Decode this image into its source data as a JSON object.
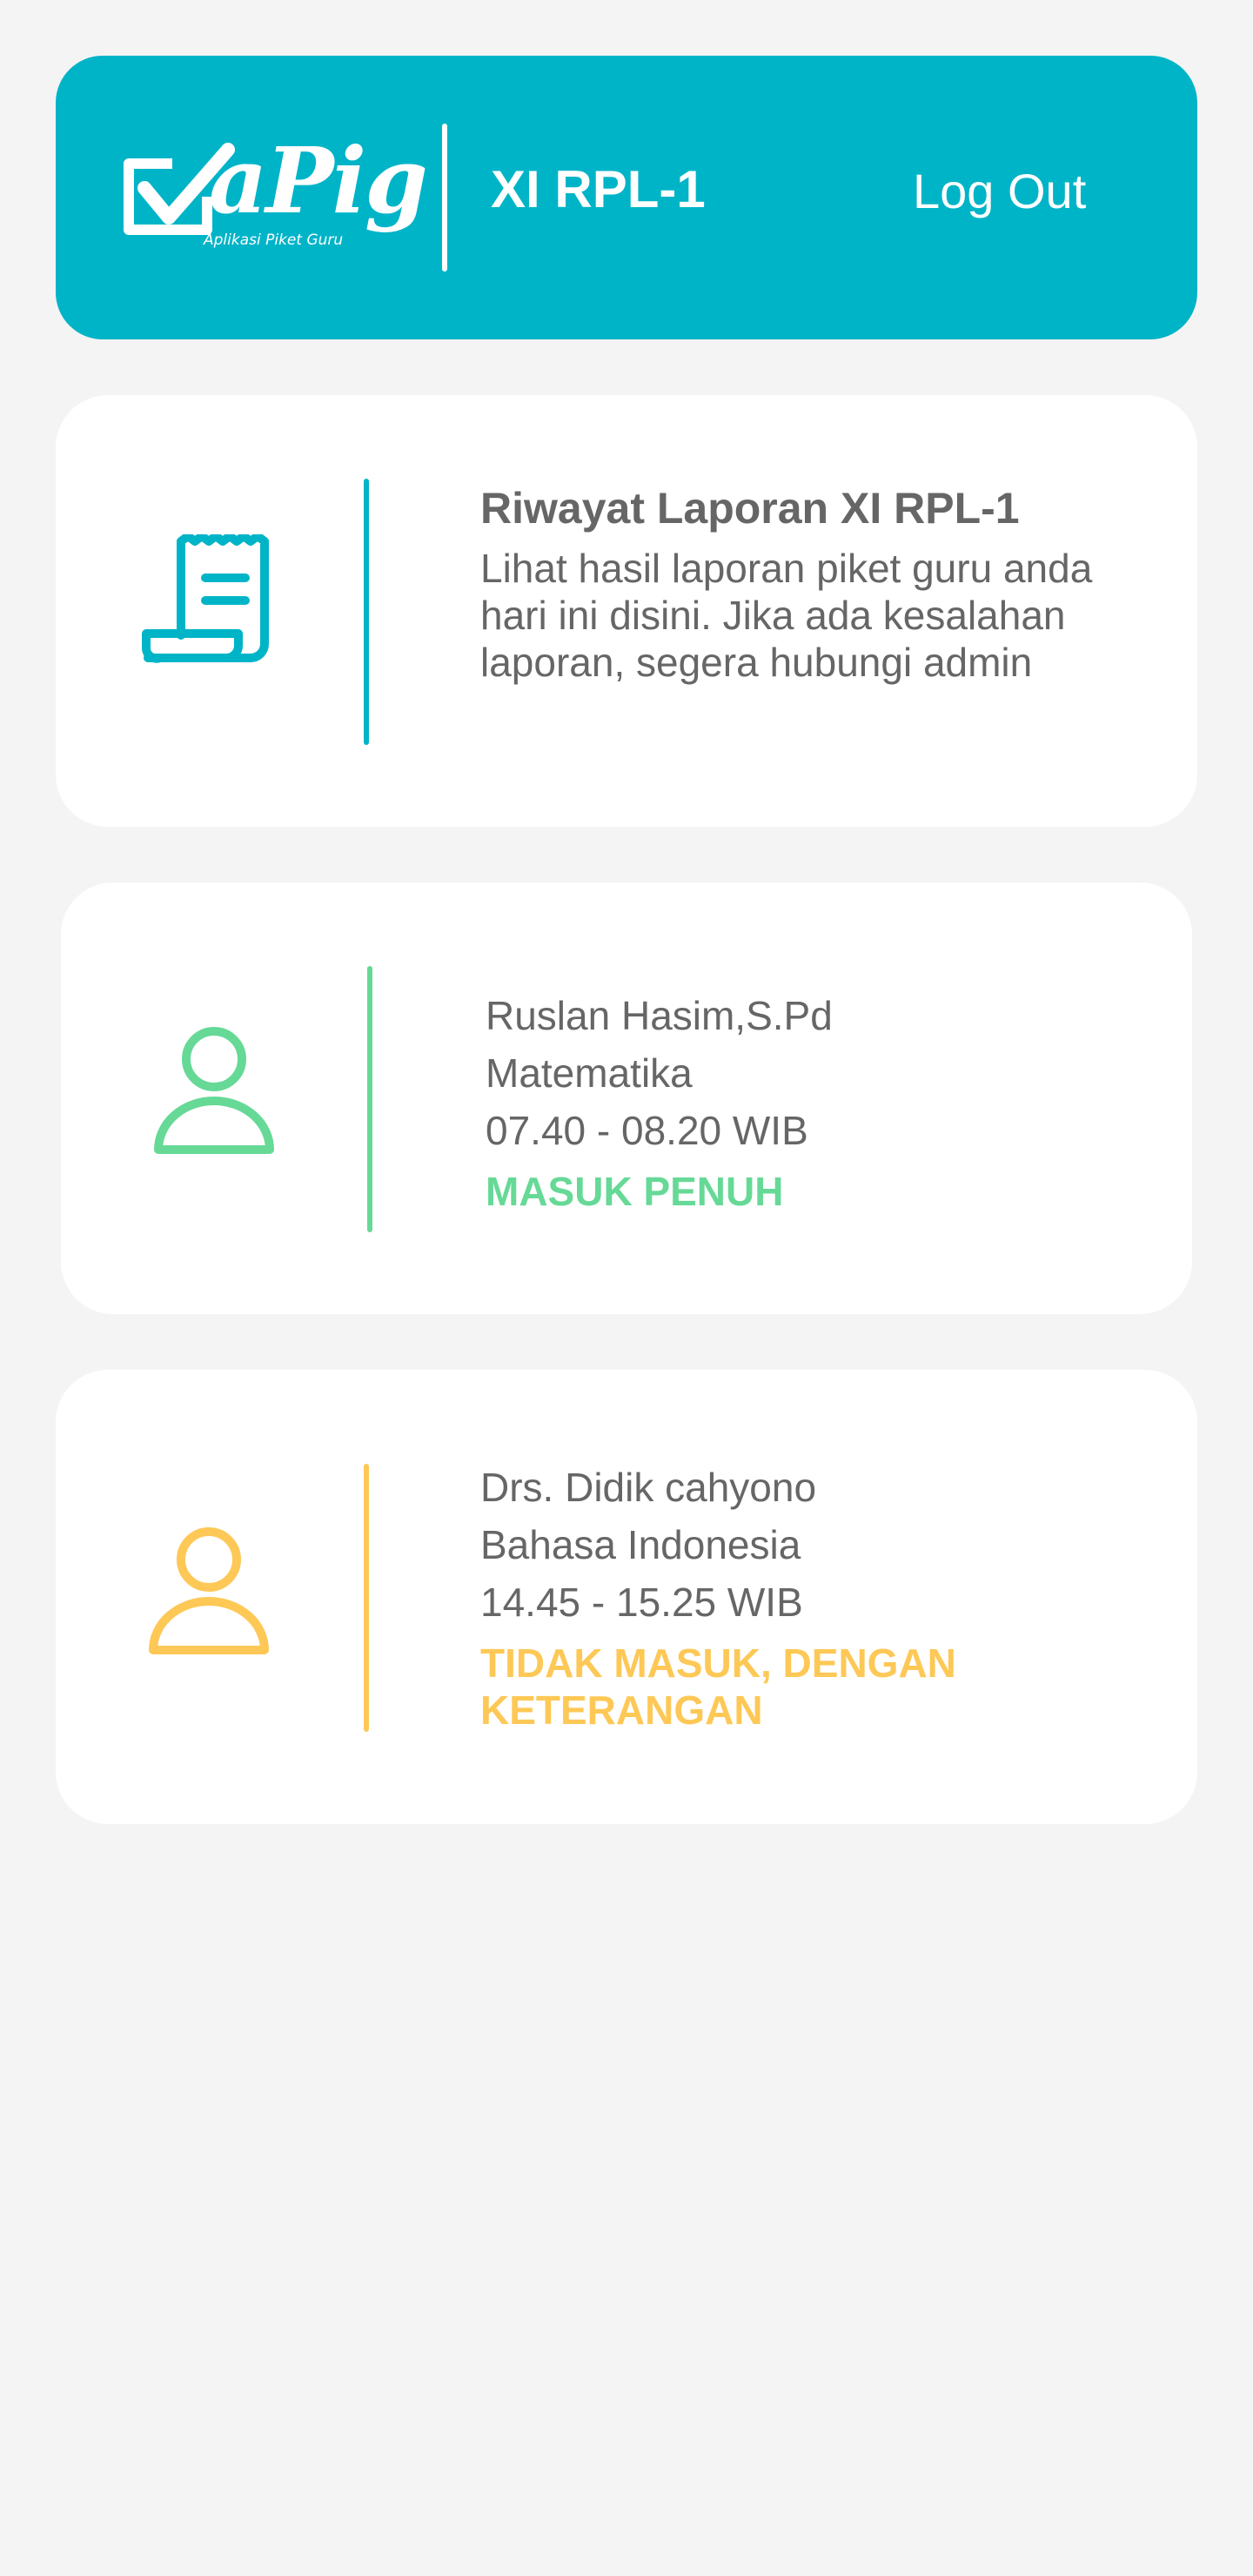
{
  "app": {
    "logo_text": "aPig",
    "logo_subtitle": "Aplikasi Piket Guru",
    "class_name": "XI RPL-1",
    "logout_label": "Log Out"
  },
  "colors": {
    "primary": "#00b4c8",
    "present": "#66d996",
    "absent": "#fdc856",
    "text": "#666666"
  },
  "report_card": {
    "icon": "receipt-scroll-icon",
    "title": "Riwayat Laporan XI RPL-1",
    "description": "Lihat hasil laporan piket guru anda hari ini disini. Jika ada kesalahan laporan, segera hubungi admin"
  },
  "teachers": [
    {
      "icon": "user-icon",
      "name": "Ruslan Hasim,S.Pd",
      "subject": "Matematika",
      "time": "07.40 - 08.20 WIB",
      "status": "MASUK PENUH",
      "status_color": "#66d996"
    },
    {
      "icon": "user-icon",
      "name": "Drs. Didik cahyono",
      "subject": "Bahasa Indonesia",
      "time": "14.45 - 15.25 WIB",
      "status": "TIDAK MASUK, DENGAN KETERANGAN",
      "status_color": "#fdc856"
    }
  ]
}
